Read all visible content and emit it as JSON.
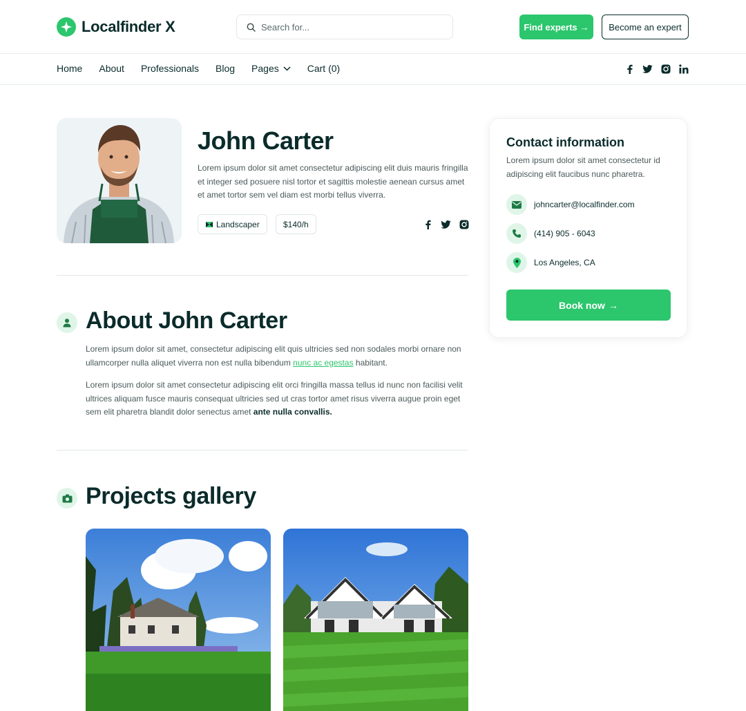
{
  "brand": {
    "name": "Localfinder X",
    "accent": "#2cc66d",
    "dark": "#0b2b2b"
  },
  "search": {
    "placeholder": "Search for..."
  },
  "header_buttons": {
    "find_experts": "Find experts",
    "become_expert": "Become an expert",
    "arrow": "→"
  },
  "nav": {
    "items": [
      {
        "label": "Home"
      },
      {
        "label": "About"
      },
      {
        "label": "Professionals"
      },
      {
        "label": "Blog"
      },
      {
        "label": "Pages"
      },
      {
        "label": "Cart (0)"
      }
    ],
    "socials": [
      "facebook-icon",
      "twitter-icon",
      "instagram-icon",
      "linkedin-icon"
    ]
  },
  "profile": {
    "name": "John Carter",
    "bio": "Lorem ipsum dolor sit amet consectetur adipiscing elit duis mauris fringilla et integer sed posuere nisl tortor et sagittis molestie aenean cursus amet et amet tortor sem vel diam est morbi tellus viverra.",
    "role": "Landscaper",
    "rate": "$140/h"
  },
  "about": {
    "title": "About John Carter",
    "p1_before": "Lorem ipsum dolor sit amet, consectetur adipiscing elit quis ultricies sed non sodales morbi ornare non ullamcorper nulla aliquet viverra non est nulla bibendum ",
    "p1_link": "nunc ac egestas",
    "p1_after": " habitant.",
    "p2_before": "Lorem ipsum dolor sit amet consectetur adipiscing elit orci fringilla massa tellus id nunc non facilisi velit ultrices aliquam fusce mauris consequat ultricies sed ut cras tortor amet risus viverra augue proin eget sem elit pharetra blandit dolor senectus amet ",
    "p2_bold": "ante nulla convallis."
  },
  "gallery": {
    "title": "Projects gallery"
  },
  "contact": {
    "title": "Contact information",
    "description": "Lorem ipsum dolor sit amet consectetur id adipiscing elit faucibus nunc pharetra.",
    "email": "johncarter@localfinder.com",
    "phone": "(414) 905 - 6043",
    "location": "Los Angeles, CA",
    "book_label": "Book now"
  }
}
